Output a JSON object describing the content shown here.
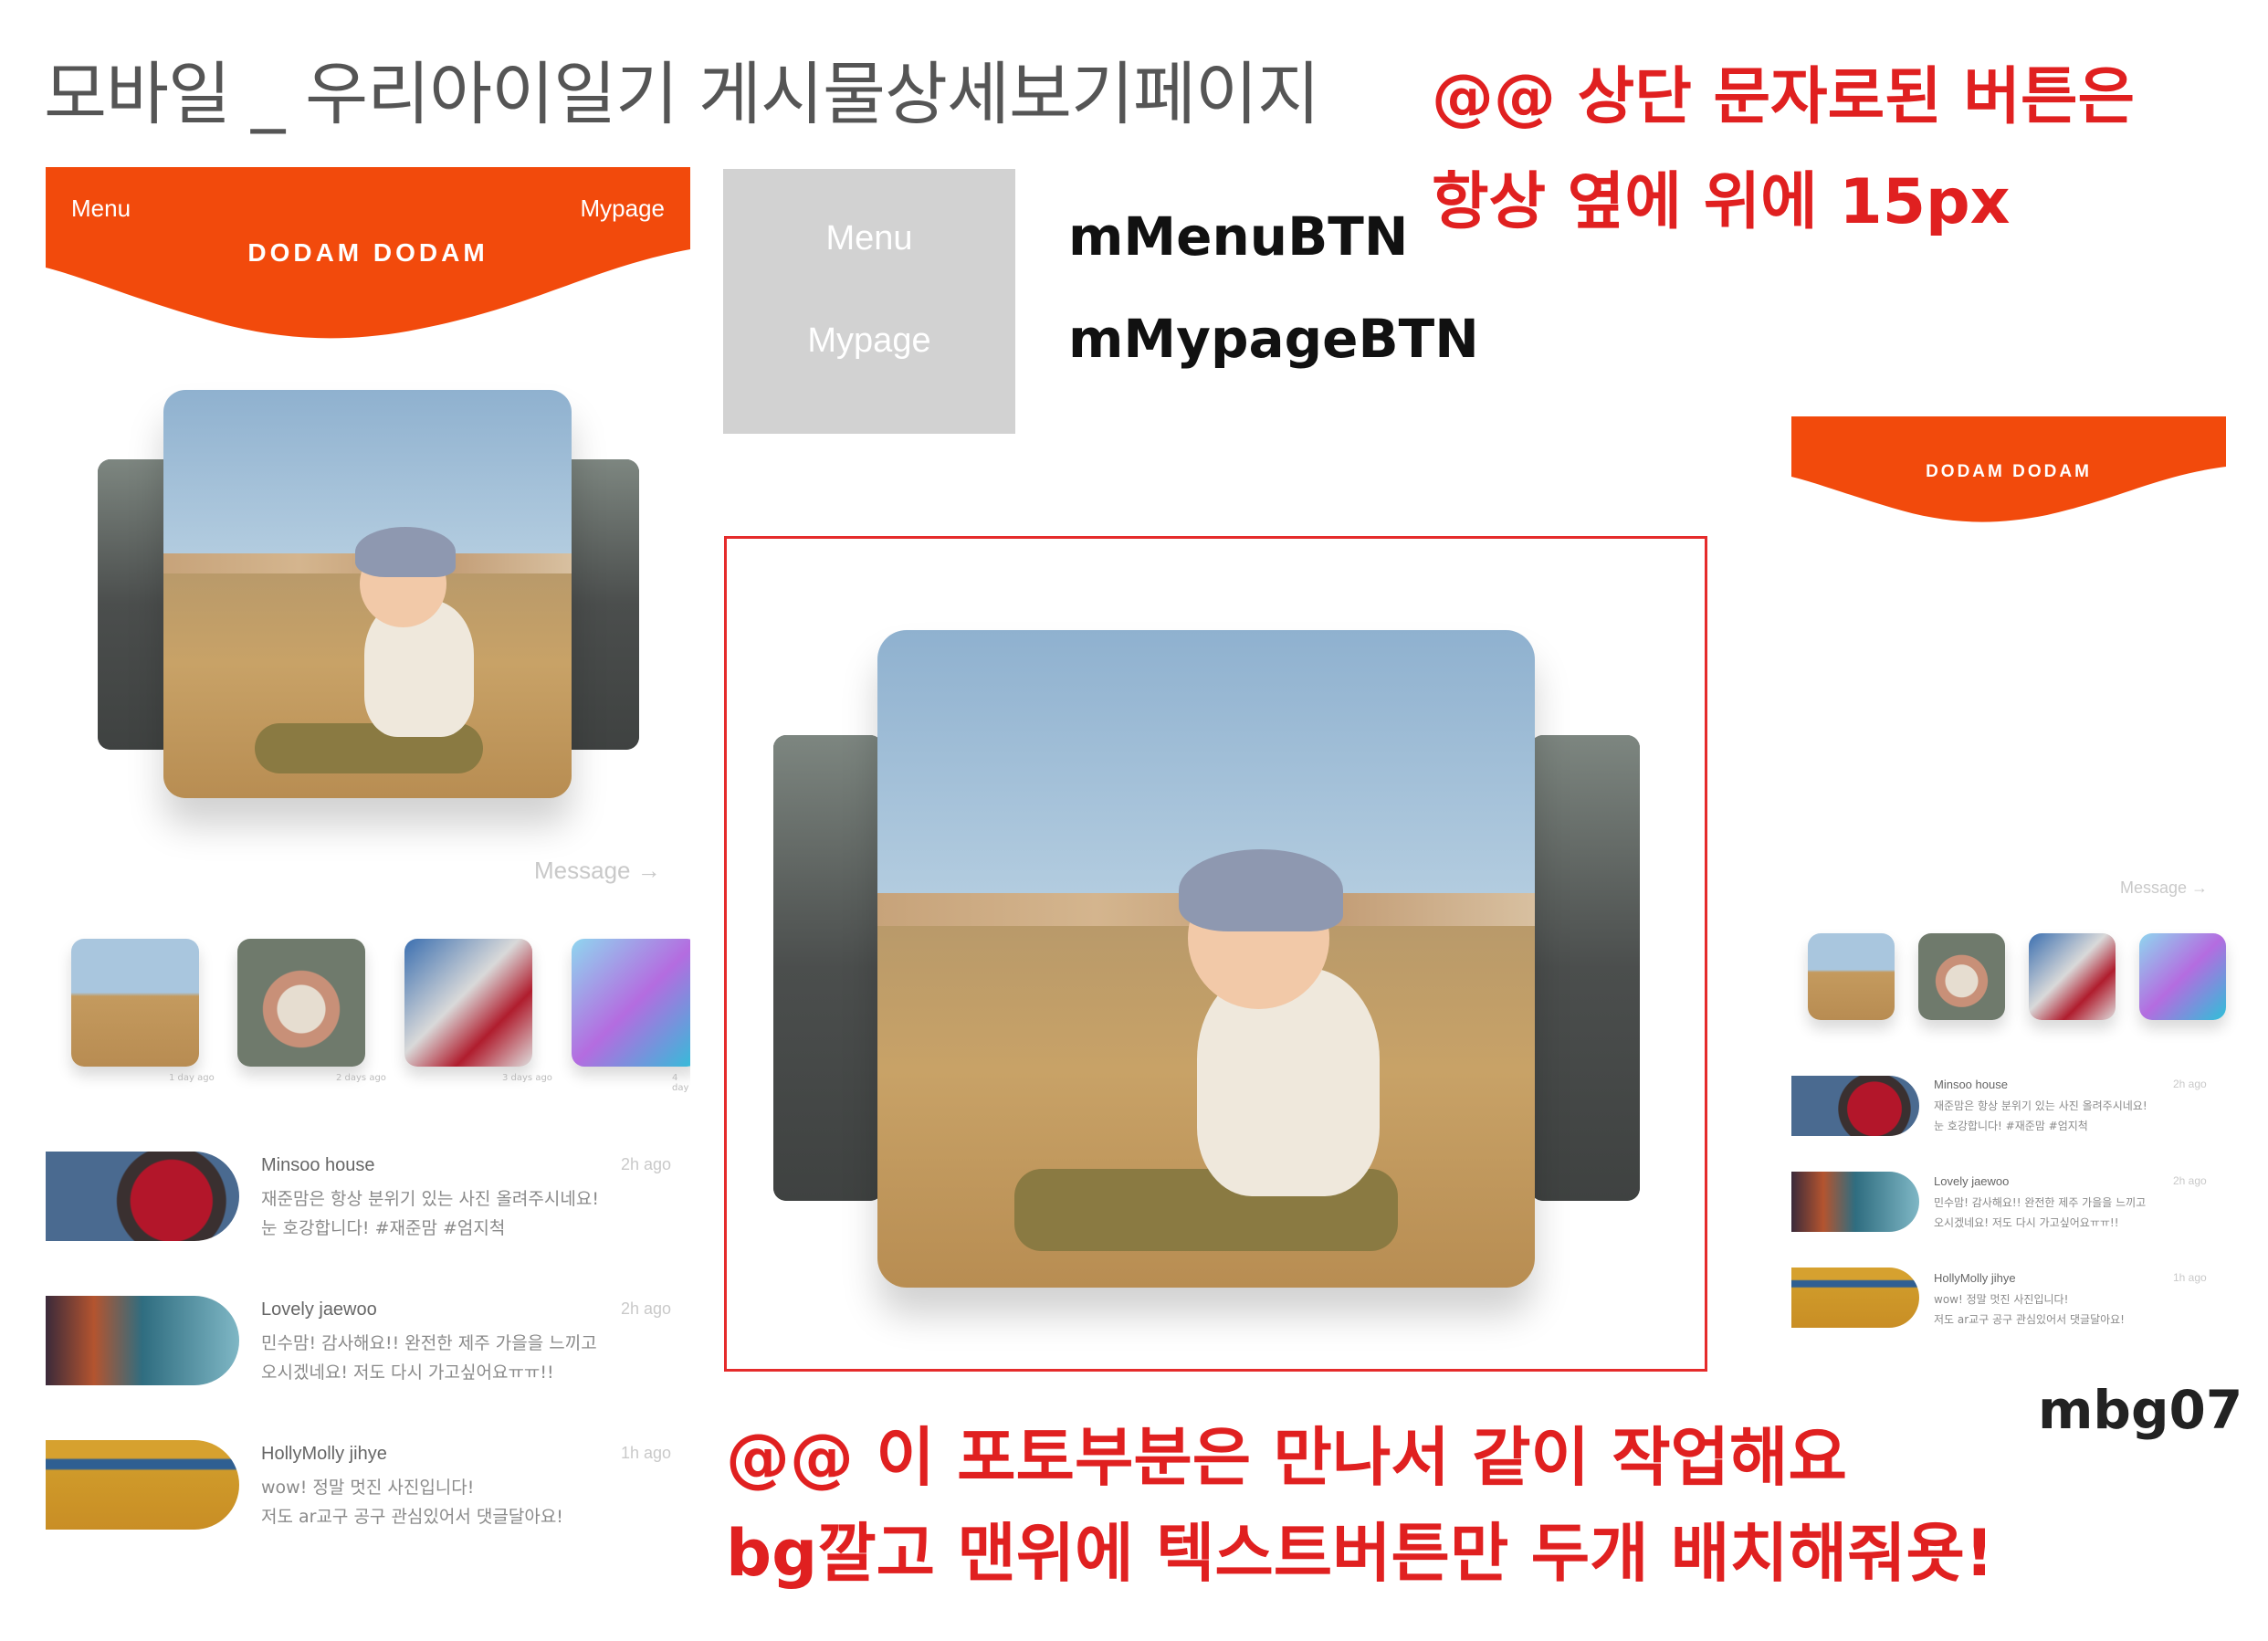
{
  "page_title": "모바일 _ 우리아이일기 게시물상세보기페이지",
  "notes": {
    "top_line1": "@@ 상단 문자로된 버튼은",
    "top_line2": "항상 옆에 위에 15px",
    "bottom_line1": "@@ 이 포토부분은 만나서 같이 작업해요",
    "bottom_line2": "bg깔고 맨위에 텍스트버튼만 두개 배치해줘욧!"
  },
  "bg_label": "mbg07",
  "buttons_spec": {
    "menu_label": "Menu",
    "mypage_label": "Mypage",
    "menu_id": "mMenuBTN",
    "mypage_id": "mMypageBTN"
  },
  "header": {
    "menu": "Menu",
    "mypage": "Mypage",
    "logo": "DODAM DODAM",
    "color": "#f24a0c"
  },
  "message_link": "Message →",
  "thumbnails": [
    {
      "icon": "beach-baby-photo",
      "caption": "1 day ago"
    },
    {
      "icon": "hand-stone-photo",
      "caption": "2 days ago"
    },
    {
      "icon": "hat-child-photo",
      "caption": "3 days ago"
    },
    {
      "icon": "isometric-art-photo",
      "caption": "4 day"
    }
  ],
  "comments": [
    {
      "name": "Minsoo house",
      "time": "2h ago",
      "line1": "재준맘은 항상 분위기 있는 사진 올려주시네요!",
      "line2": "눈 호강합니다! #재준맘 #엄지척",
      "icon": "apple-photo"
    },
    {
      "name": "Lovely jaewoo",
      "time": "2h ago",
      "line1": "민수맘! 감사해요!! 완전한 제주 가을을 느끼고",
      "line2": "오시겠네요! 저도 다시 가고싶어요ㅠㅠ!!",
      "icon": "mural-photo"
    },
    {
      "name": "HollyMolly jihye",
      "time": "1h ago",
      "line1": "wow! 정말 멋진 사진입니다!",
      "line2": "저도 ar교구 공구 관심있어서 댓글달아요!",
      "icon": "shelf-photo"
    }
  ],
  "preview_right": {
    "logo": "DODAM DODAM",
    "message_link": "Message →",
    "comments": [
      {
        "name": "Minsoo house",
        "time": "2h ago",
        "line1": "재준맘은 항상 분위기 있는 사진 올려주시네요!",
        "line2": "눈 호강합니다! #재준맘 #엄지척"
      },
      {
        "name": "Lovely jaewoo",
        "time": "2h ago",
        "line1": "민수맘! 감사해요!! 완전한 제주 가을을 느끼고",
        "line2": "오시겠네요! 저도 다시 가고싶어요ㅠㅠ!!"
      },
      {
        "name": "HollyMolly jihye",
        "time": "1h ago",
        "line1": "wow! 정말 멋진 사진입니다!",
        "line2": "저도 ar교구 공구 관심있어서 댓글달아요!"
      }
    ]
  },
  "colors": {
    "accent": "#f24a0c",
    "annotation_red": "#e02020",
    "frame_red": "#e52b2b",
    "gray_box": "#d2d2d2"
  }
}
